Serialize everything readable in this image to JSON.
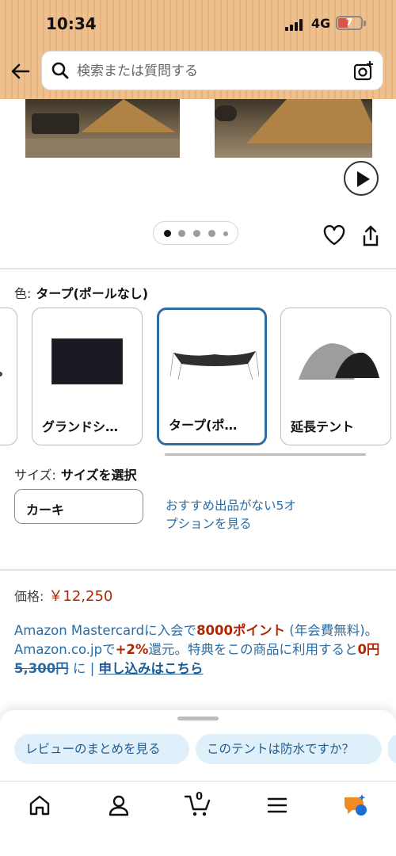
{
  "status_bar": {
    "time": "10:34",
    "network": "4G",
    "battery": "7"
  },
  "header": {
    "search_placeholder": "検索または質問する",
    "icons": [
      "back-arrow-icon",
      "search-icon",
      "camera-search-icon"
    ]
  },
  "gallery": {
    "dots": 5,
    "active_dot": 1,
    "icons": [
      "play-icon",
      "heart-icon",
      "share-icon"
    ]
  },
  "color": {
    "label": "色:",
    "selected": "タープ(ポールなし)",
    "options": [
      {
        "name": "グランドシ…",
        "thumb": "dark-ground-sheet"
      },
      {
        "name": "タープ(ポ…",
        "thumb": "tarp",
        "selected": true
      },
      {
        "name": "延長テント",
        "thumb": "extension-tent"
      }
    ]
  },
  "size": {
    "label": "サイズ:",
    "selected": "サイズを選択",
    "value": "カーキ",
    "offers_link": "おすすめ出品がない5オプションを見る"
  },
  "price": {
    "label": "価格:",
    "amount": "￥12,250"
  },
  "promo": {
    "text1": "Amazon Mastercardに入会で",
    "points": "8000ポイント",
    "text2": " (年会費無料)。 Amazon.co.jpで",
    "rate": "+2%",
    "text3": "還元。特典をこの商品に利用すると",
    "price_zero": "0円",
    "space": " ",
    "original": "5,300円",
    "text4": " に | ",
    "link": "申し込みはこちら"
  },
  "suggestions": [
    "レビューのまとめを見る",
    "このテントは防水ですか？"
  ],
  "nav": {
    "cart_count": "0",
    "icons": [
      "home-icon",
      "account-icon",
      "cart-icon",
      "menu-icon",
      "rufus-assistant-icon"
    ]
  },
  "colors": {
    "header_bg": "#edc08e",
    "link": "#2a6ca5",
    "price": "#b12704",
    "selected_border": "#2f6c9f",
    "chip_bg": "#e0f0fa"
  }
}
